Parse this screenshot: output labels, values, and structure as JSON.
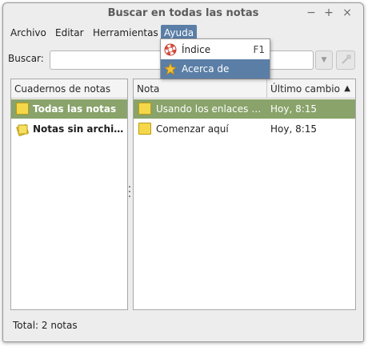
{
  "window": {
    "title": "Buscar en todas las notas"
  },
  "titlebar_buttons": {
    "minimize": "−",
    "maximize": "+",
    "close": "×"
  },
  "menubar": {
    "archivo": "Archivo",
    "editar": "Editar",
    "herramientas": "Herramientas",
    "ayuda": "Ayuda"
  },
  "search": {
    "label": "Buscar:",
    "value": ""
  },
  "help_menu": {
    "items": [
      {
        "label": "Índice",
        "shortcut": "F1",
        "icon": "lifebuoy-icon"
      },
      {
        "label": "Acerca de",
        "icon": "star-icon"
      }
    ]
  },
  "notebooks": {
    "header": "Cuadernos de notas",
    "items": [
      {
        "label": "Todas las notas",
        "selected": true
      },
      {
        "label": "Notas sin archi…",
        "selected": false
      }
    ]
  },
  "notes": {
    "headers": {
      "title": "Nota",
      "changed": "Último cambio",
      "sort_indicator": "▲"
    },
    "rows": [
      {
        "title": "Usando los enlaces …",
        "changed": "Hoy, 8:15",
        "selected": true
      },
      {
        "title": "Comenzar aquí",
        "changed": "Hoy, 8:15",
        "selected": false
      }
    ]
  },
  "status": {
    "text": "Total: 2 notas"
  },
  "colors": {
    "selection": "#89a36a",
    "menu_highlight": "#5a7ea6",
    "note_icon": "#f5d84a"
  }
}
